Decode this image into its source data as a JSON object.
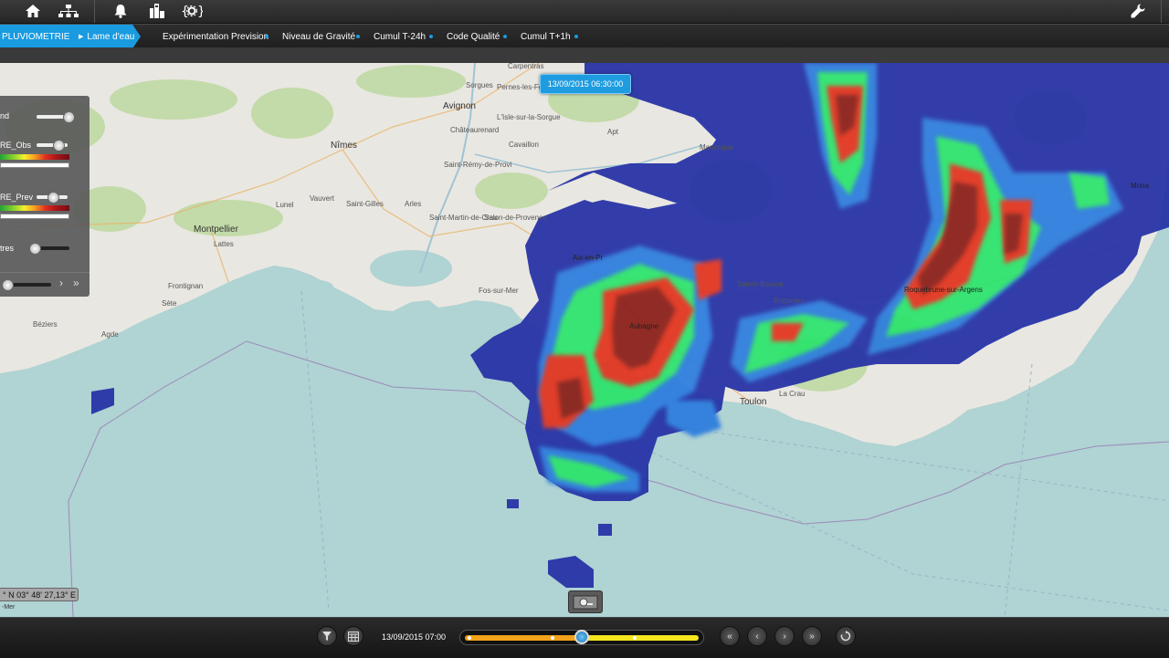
{
  "topbar": {
    "icons": [
      "home-icon",
      "sitemap-icon",
      "bell-icon",
      "report-icon",
      "settings-brackets-icon",
      "wrench-icon"
    ]
  },
  "nav": {
    "breadcrumb": [
      "PLUVIOMETRIE",
      "Lame d'eau"
    ],
    "tabs": [
      "Expérimentation Prevision",
      "Niveau de Gravité",
      "Cumul T-24h",
      "Code Qualité",
      "Cumul T+1h"
    ]
  },
  "map": {
    "timestamp": "13/09/2015 06:30:00",
    "places": [
      {
        "name": "Carpentras"
      },
      {
        "name": "Avignon"
      },
      {
        "name": "Sorgues"
      },
      {
        "name": "Pernes-les-Font"
      },
      {
        "name": "L'Isle-sur-la-Sorgue"
      },
      {
        "name": "Châteaurenard"
      },
      {
        "name": "Cavaillon"
      },
      {
        "name": "Apt"
      },
      {
        "name": "Nîmes"
      },
      {
        "name": "Saint-Rémy-de-Provi"
      },
      {
        "name": "Manosque"
      },
      {
        "name": "Vauvert"
      },
      {
        "name": "Lunel"
      },
      {
        "name": "Saint-Gilles"
      },
      {
        "name": "Arles"
      },
      {
        "name": "Saint-Martin-de-Crau"
      },
      {
        "name": "Salon-de-Provence"
      },
      {
        "name": "Montpellier"
      },
      {
        "name": "Lattes"
      },
      {
        "name": "Frontignan"
      },
      {
        "name": "Sète"
      },
      {
        "name": "Agde"
      },
      {
        "name": "Béziers"
      },
      {
        "name": "Fos-sur-Mer"
      },
      {
        "name": "Aix-en-Pr"
      },
      {
        "name": "Aubagne"
      },
      {
        "name": "Toulon"
      },
      {
        "name": "La Crau"
      },
      {
        "name": "Brignoles"
      },
      {
        "name": "Sainte-Baume"
      },
      {
        "name": "Mona"
      },
      {
        "name": "Roquebrune-sur-Argens"
      }
    ],
    "coords": "° N 03° 48' 27,13° E",
    "attribution": "-Mer"
  },
  "panel": {
    "layers": [
      {
        "label": "nd",
        "opacity": 0.95
      },
      {
        "label": "RE_Obs",
        "opacity": 0.7
      },
      {
        "label": "RE_Prev",
        "opacity": 0.7
      },
      {
        "label": "tres",
        "opacity": 0.1
      }
    ],
    "time_position": 0.05,
    "nav_next": "›",
    "nav_last": "»"
  },
  "bottom": {
    "current_time": "13/09/2015 07:00",
    "timeline_position": 0.5,
    "buttons": [
      "filter-icon",
      "calendar-icon",
      "first-icon",
      "prev-icon",
      "next-icon",
      "last-icon",
      "refresh-icon"
    ]
  },
  "colors": {
    "accent": "#1a9be0",
    "sea": "#b0d3d3",
    "land": "#e8e6e0",
    "rain_low": "#232fa6",
    "rain_mid": "#29e46b",
    "rain_high": "#e3301f",
    "rain_max": "#8a1e18"
  }
}
